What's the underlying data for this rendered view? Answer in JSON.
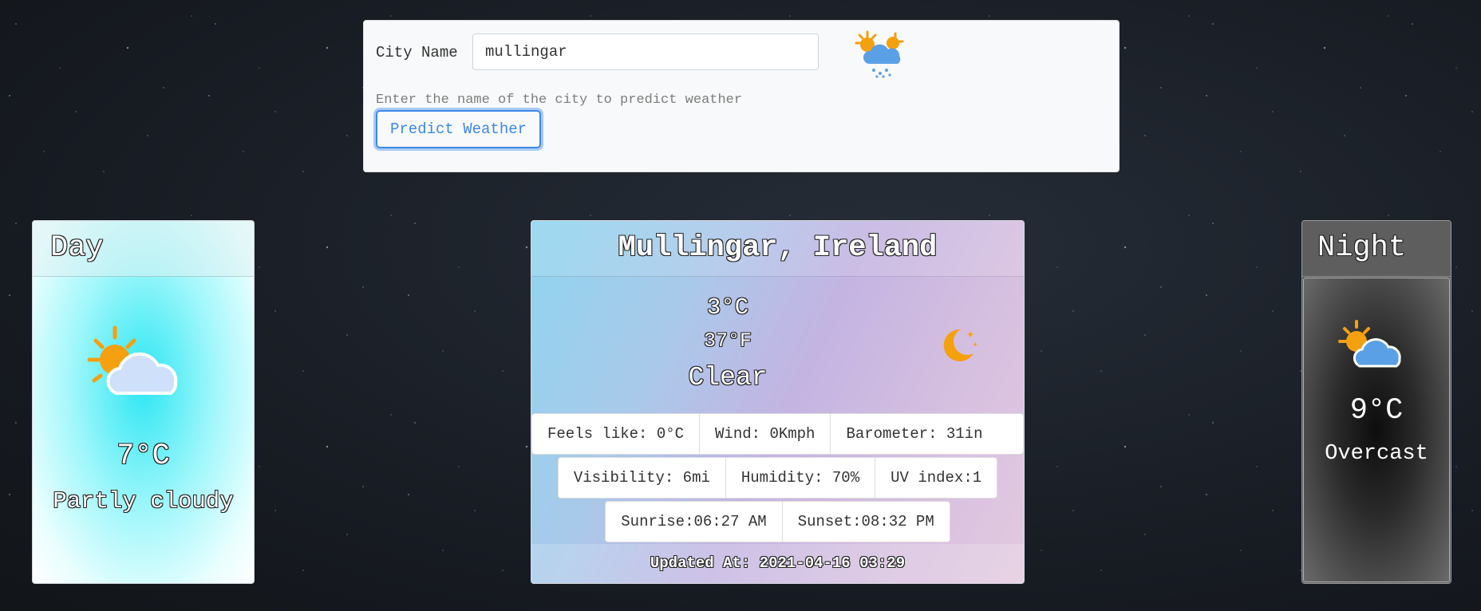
{
  "search": {
    "label": "City Name",
    "value": "mullingar",
    "help": "Enter the name of the city to predict weather",
    "button": "Predict Weather",
    "logo_icon": "sun-cloud-snow-icon"
  },
  "day": {
    "title": "Day",
    "temp": "7°C",
    "condition": "Partly cloudy",
    "icon": "partly-cloudy-icon"
  },
  "current": {
    "location": "Mullingar, Ireland",
    "temp_c": "3°C",
    "temp_f": "37°F",
    "condition": "Clear",
    "icon": "moon-icon",
    "stats_row1": [
      "Feels like: 0°C",
      "Wind: 0Kmph",
      "Barometer: 31in"
    ],
    "stats_row2": [
      "Visibility: 6mi",
      "Humidity: 70%",
      "UV index:1"
    ],
    "stats_row3": [
      "Sunrise:06:27 AM",
      "Sunset:08:32 PM"
    ],
    "updated": "Updated At: 2021-04-16 03:29"
  },
  "night": {
    "title": "Night",
    "temp": "9°C",
    "condition": "Overcast",
    "icon": "partly-cloudy-icon"
  },
  "colors": {
    "accent": "#3d88e8",
    "sun": "#f5a00f",
    "cloud_day": "#cfe0fb",
    "cloud_night": "#5aa0e6"
  }
}
